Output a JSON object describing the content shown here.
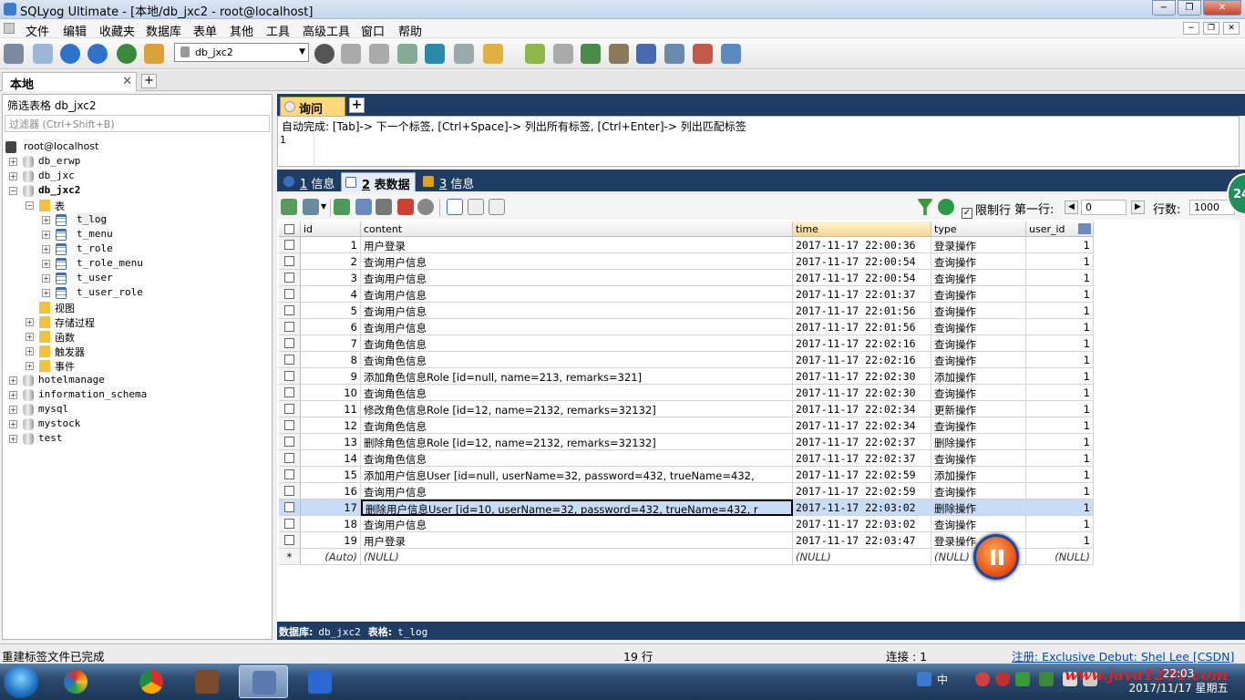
{
  "window": {
    "title": "SQLyog Ultimate - [本地/db_jxc2 - root@localhost]",
    "minimize": "−",
    "maximize": "❐",
    "close": "✕"
  },
  "menu": {
    "items": [
      "文件",
      "编辑",
      "收藏夹",
      "数据库",
      "表单",
      "其他",
      "工具",
      "高级工具",
      "窗口",
      "帮助"
    ],
    "mdi": [
      "−",
      "❐",
      "✕"
    ]
  },
  "toolbar": {
    "database_select": "db_jxc2"
  },
  "connection_tab": {
    "label": "本地",
    "close": "✕",
    "add": "+"
  },
  "object_browser": {
    "filter_label": "筛选表格 db_jxc2",
    "filter_placeholder": "过滤器 (Ctrl+Shift+B)",
    "root": "root@localhost",
    "nodes": [
      {
        "label": "db_erwp",
        "pm": "+"
      },
      {
        "label": "db_jxc",
        "pm": "+"
      },
      {
        "label": "db_jxc2",
        "pm": "−"
      },
      {
        "label": "表",
        "pm": "−"
      },
      {
        "label": "t_log",
        "pm": "+"
      },
      {
        "label": "t_menu",
        "pm": "+"
      },
      {
        "label": "t_role",
        "pm": "+"
      },
      {
        "label": "t_role_menu",
        "pm": "+"
      },
      {
        "label": "t_user",
        "pm": "+"
      },
      {
        "label": "t_user_role",
        "pm": "+"
      },
      {
        "label": "视图",
        "pm": ""
      },
      {
        "label": "存储过程",
        "pm": "+"
      },
      {
        "label": "函数",
        "pm": "+"
      },
      {
        "label": "触发器",
        "pm": "+"
      },
      {
        "label": "事件",
        "pm": "+"
      },
      {
        "label": "hotelmanage",
        "pm": "+"
      },
      {
        "label": "information_schema",
        "pm": "+"
      },
      {
        "label": "mysql",
        "pm": "+"
      },
      {
        "label": "mystock",
        "pm": "+"
      },
      {
        "label": "test",
        "pm": "+"
      }
    ]
  },
  "query": {
    "tab_label": "询问",
    "add": "+",
    "autocomplete_hint": "自动完成: [Tab]-> 下一个标签, [Ctrl+Space]-> 列出所有标签, [Ctrl+Enter]-> 列出匹配标签",
    "line_number": "1"
  },
  "result_tabs": {
    "tab1_num": "1",
    "tab1_label": "信息",
    "tab2_num": "2",
    "tab2_label": "表数据",
    "tab3_num": "3",
    "tab3_label": "信息"
  },
  "grid_toolbar": {
    "limit_label": "限制行",
    "limit_check": "✓",
    "first_row_label": "第一行:",
    "first_row_value": "0",
    "rows_label": "行数:",
    "rows_value": "1000",
    "prev": "◀",
    "next": "▶"
  },
  "table": {
    "columns": [
      "id",
      "content",
      "time",
      "type",
      "user_id"
    ],
    "rows": [
      {
        "id": "1",
        "content": "用户登录",
        "time": "2017-11-17 22:00:36",
        "type": "登录操作",
        "user_id": "1"
      },
      {
        "id": "2",
        "content": "查询用户信息",
        "time": "2017-11-17 22:00:54",
        "type": "查询操作",
        "user_id": "1"
      },
      {
        "id": "3",
        "content": "查询用户信息",
        "time": "2017-11-17 22:00:54",
        "type": "查询操作",
        "user_id": "1"
      },
      {
        "id": "4",
        "content": "查询用户信息",
        "time": "2017-11-17 22:01:37",
        "type": "查询操作",
        "user_id": "1"
      },
      {
        "id": "5",
        "content": "查询用户信息",
        "time": "2017-11-17 22:01:56",
        "type": "查询操作",
        "user_id": "1"
      },
      {
        "id": "6",
        "content": "查询用户信息",
        "time": "2017-11-17 22:01:56",
        "type": "查询操作",
        "user_id": "1"
      },
      {
        "id": "7",
        "content": "查询角色信息",
        "time": "2017-11-17 22:02:16",
        "type": "查询操作",
        "user_id": "1"
      },
      {
        "id": "8",
        "content": "查询角色信息",
        "time": "2017-11-17 22:02:16",
        "type": "查询操作",
        "user_id": "1"
      },
      {
        "id": "9",
        "content": "添加角色信息Role [id=null, name=213, remarks=321]",
        "time": "2017-11-17 22:02:30",
        "type": "添加操作",
        "user_id": "1"
      },
      {
        "id": "10",
        "content": "查询角色信息",
        "time": "2017-11-17 22:02:30",
        "type": "查询操作",
        "user_id": "1"
      },
      {
        "id": "11",
        "content": "修改角色信息Role [id=12, name=2132, remarks=32132]",
        "time": "2017-11-17 22:02:34",
        "type": "更新操作",
        "user_id": "1"
      },
      {
        "id": "12",
        "content": "查询角色信息",
        "time": "2017-11-17 22:02:34",
        "type": "查询操作",
        "user_id": "1"
      },
      {
        "id": "13",
        "content": "删除角色信息Role [id=12, name=2132, remarks=32132]",
        "time": "2017-11-17 22:02:37",
        "type": "删除操作",
        "user_id": "1"
      },
      {
        "id": "14",
        "content": "查询角色信息",
        "time": "2017-11-17 22:02:37",
        "type": "查询操作",
        "user_id": "1"
      },
      {
        "id": "15",
        "content": "添加用户信息User [id=null, userName=32, password=432, trueName=432,",
        "time": "2017-11-17 22:02:59",
        "type": "添加操作",
        "user_id": "1"
      },
      {
        "id": "16",
        "content": "查询用户信息",
        "time": "2017-11-17 22:02:59",
        "type": "查询操作",
        "user_id": "1"
      },
      {
        "id": "17",
        "content": "删除用户信息User [id=10, userName=32, password=432, trueName=432, r",
        "time": "2017-11-17 22:03:02",
        "type": "删除操作",
        "user_id": "1"
      },
      {
        "id": "18",
        "content": "查询用户信息",
        "time": "2017-11-17 22:03:02",
        "type": "查询操作",
        "user_id": "1"
      },
      {
        "id": "19",
        "content": "用户登录",
        "time": "2017-11-17 22:03:47",
        "type": "登录操作",
        "user_id": "1"
      }
    ],
    "selected_row_id": "17",
    "new_row": {
      "marker": "*",
      "id": "(Auto)",
      "content": "(NULL)",
      "time": "(NULL)",
      "type": "(NULL)",
      "user_id": "(NULL)"
    }
  },
  "grid_status": {
    "db_label": "数据库:",
    "db_value": "db_jxc2",
    "table_label": "表格:",
    "table_value": "t_log"
  },
  "statusbar": {
    "left": "重建标签文件已完成",
    "rows": "19 行",
    "connections": "连接 : 1",
    "registration": "注册:  Exclusive Debut: Shel Lee [CSDN]"
  },
  "taskbar": {
    "time": "22:03",
    "date": "2017/11/17 星期五",
    "watermark": "www.java1234.com",
    "side_badge": "24",
    "ime": "中"
  },
  "colors": {
    "accent_dark": "#1f3c63",
    "selected_row": "#c8dcf5",
    "query_tab": "#ffd87c"
  }
}
